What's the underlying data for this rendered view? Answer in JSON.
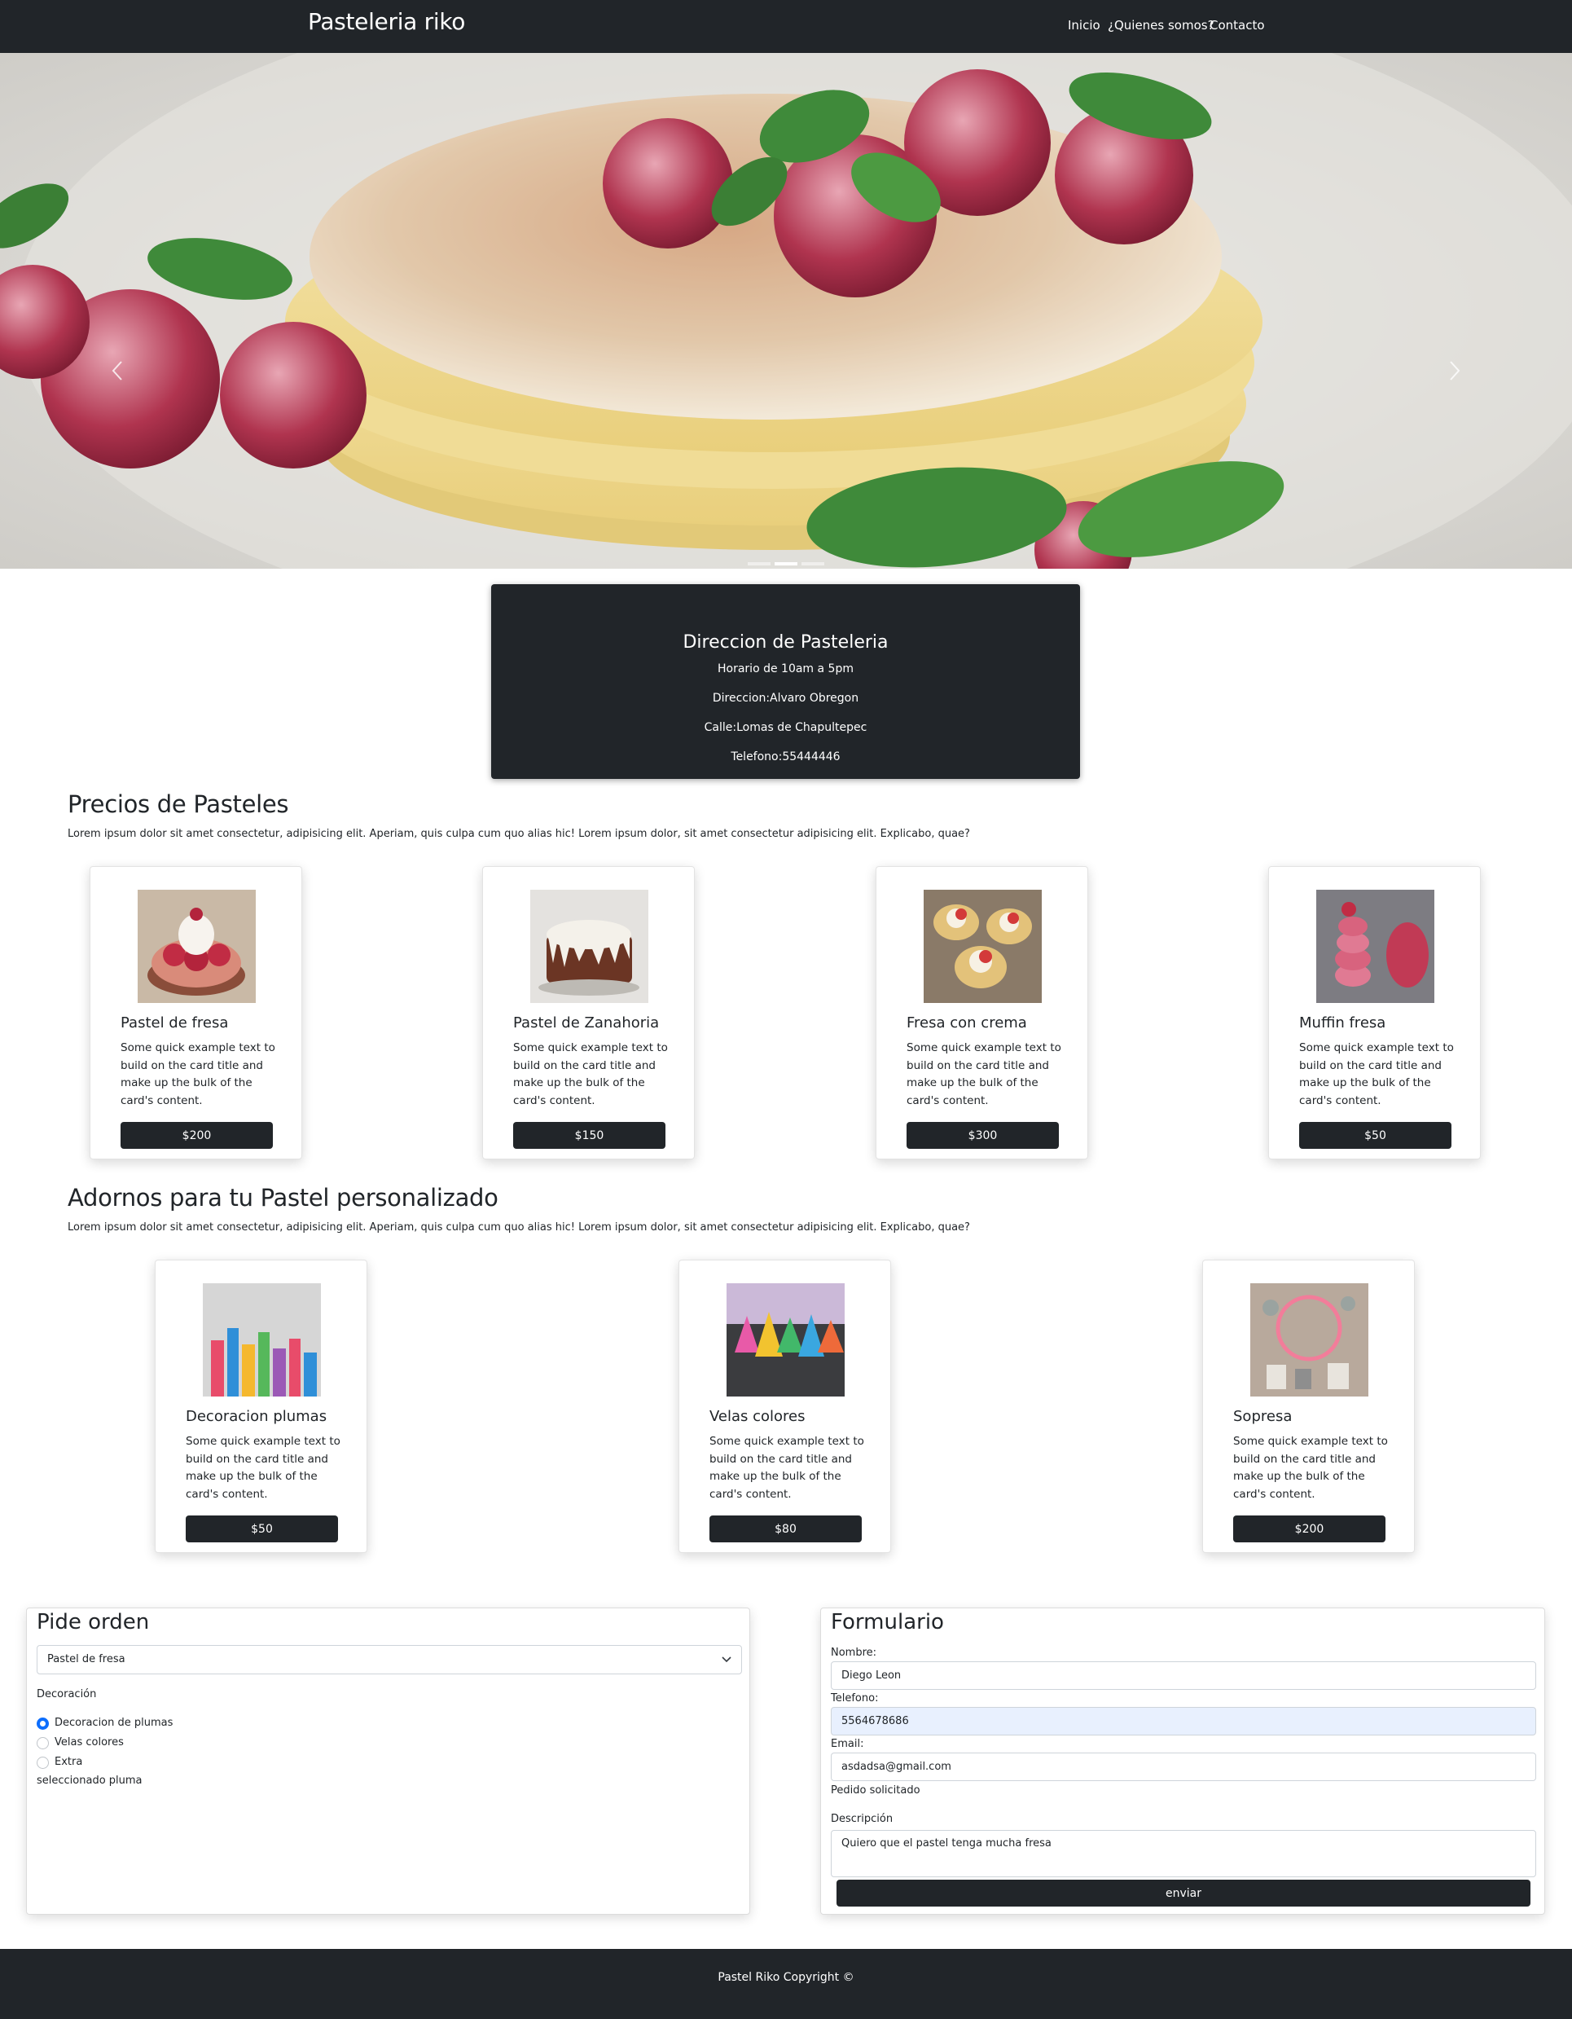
{
  "navbar": {
    "brand": "Pasteleria riko",
    "links": [
      "Inicio",
      "¿Quienes somos?",
      "Contacto"
    ]
  },
  "carousel": {
    "slide_count": 3,
    "active_index": 1,
    "prev_icon": "chevron-left-icon",
    "next_icon": "chevron-right-icon"
  },
  "address": {
    "title": "Direccion de Pasteleria",
    "lines": [
      "Horario de 10am a 5pm",
      "Direccion:Alvaro Obregon",
      "Calle:Lomas de Chapultepec",
      "Telefono:55444446"
    ]
  },
  "prices": {
    "title": "Precios de Pasteles",
    "text": "Lorem ipsum dolor sit amet consectetur, adipisicing elit. Aperiam, quis culpa cum quo alias hic! Lorem ipsum dolor, sit amet consectetur adipisicing elit. Explicabo, quae?",
    "cards": [
      {
        "title": "Pastel de fresa",
        "text": "Some quick example text to build on the card title and make up the bulk of the card's content.",
        "price": "$200"
      },
      {
        "title": "Pastel de Zanahoria",
        "text": "Some quick example text to build on the card title and make up the bulk of the card's content.",
        "price": "$150"
      },
      {
        "title": "Fresa con crema",
        "text": "Some quick example text to build on the card title and make up the bulk of the card's content.",
        "price": "$300"
      },
      {
        "title": "Muffin fresa",
        "text": "Some quick example text to build on the card title and make up the bulk of the card's content.",
        "price": "$50"
      }
    ]
  },
  "decorations": {
    "title": "Adornos para tu Pastel personalizado",
    "text": "Lorem ipsum dolor sit amet consectetur, adipisicing elit. Aperiam, quis culpa cum quo alias hic! Lorem ipsum dolor, sit amet consectetur adipisicing elit. Explicabo, quae?",
    "cards": [
      {
        "title": "Decoracion plumas",
        "text": "Some quick example text to build on the card title and make up the bulk of the card's content.",
        "price": "$50"
      },
      {
        "title": "Velas colores",
        "text": "Some quick example text to build on the card title and make up the bulk of the card's content.",
        "price": "$80"
      },
      {
        "title": "Sopresa",
        "text": "Some quick example text to build on the card title and make up the bulk of the card's content.",
        "price": "$200"
      }
    ]
  },
  "order": {
    "title": "Pide orden",
    "select_value": "Pastel de fresa",
    "decoration_label": "Decoración",
    "options": [
      "Decoracion de plumas",
      "Velas colores",
      "Extra"
    ],
    "selected_index": 0,
    "selected_text": "seleccionado pluma"
  },
  "form": {
    "title": "Formulario",
    "name_label": "Nombre:",
    "name_value": "Diego Leon",
    "phone_label": "Telefono:",
    "phone_value": "5564678686",
    "email_label": "Email:",
    "email_value": "asdadsa@gmail.com",
    "requested_label": "Pedido solicitado",
    "desc_label": "Descripción",
    "desc_value": "Quiero que el pastel tenga mucha fresa",
    "submit": "enviar"
  },
  "footer": {
    "text": "Pastel Riko Copyright ©"
  },
  "colors": {
    "dark": "#212529",
    "accent": "#0d6efd",
    "autofill": "#e8f0fe"
  }
}
